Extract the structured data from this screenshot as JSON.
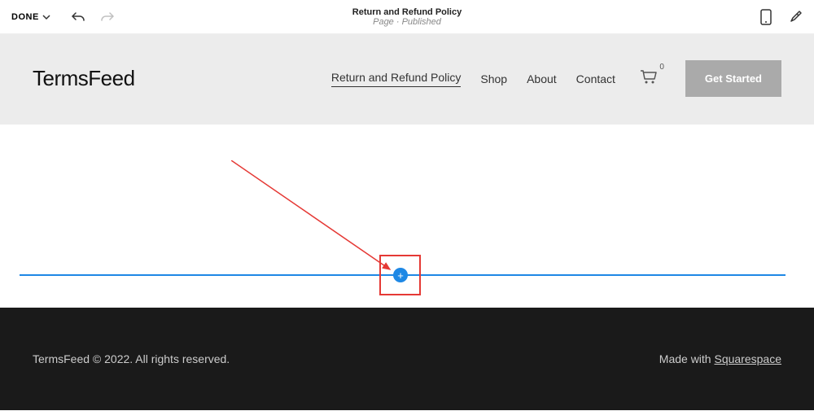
{
  "topbar": {
    "done_label": "DONE",
    "title": "Return and Refund Policy",
    "subtitle": "Page · Published"
  },
  "site": {
    "logo": "TermsFeed",
    "nav": [
      "Return and Refund Policy",
      "Shop",
      "About",
      "Contact"
    ],
    "cart_count": "0",
    "cta": "Get Started"
  },
  "editor": {
    "add_label": "+"
  },
  "footer": {
    "copyright": "TermsFeed © 2022. All rights reserved.",
    "made_prefix": "Made with ",
    "made_link": "Squarespace"
  }
}
